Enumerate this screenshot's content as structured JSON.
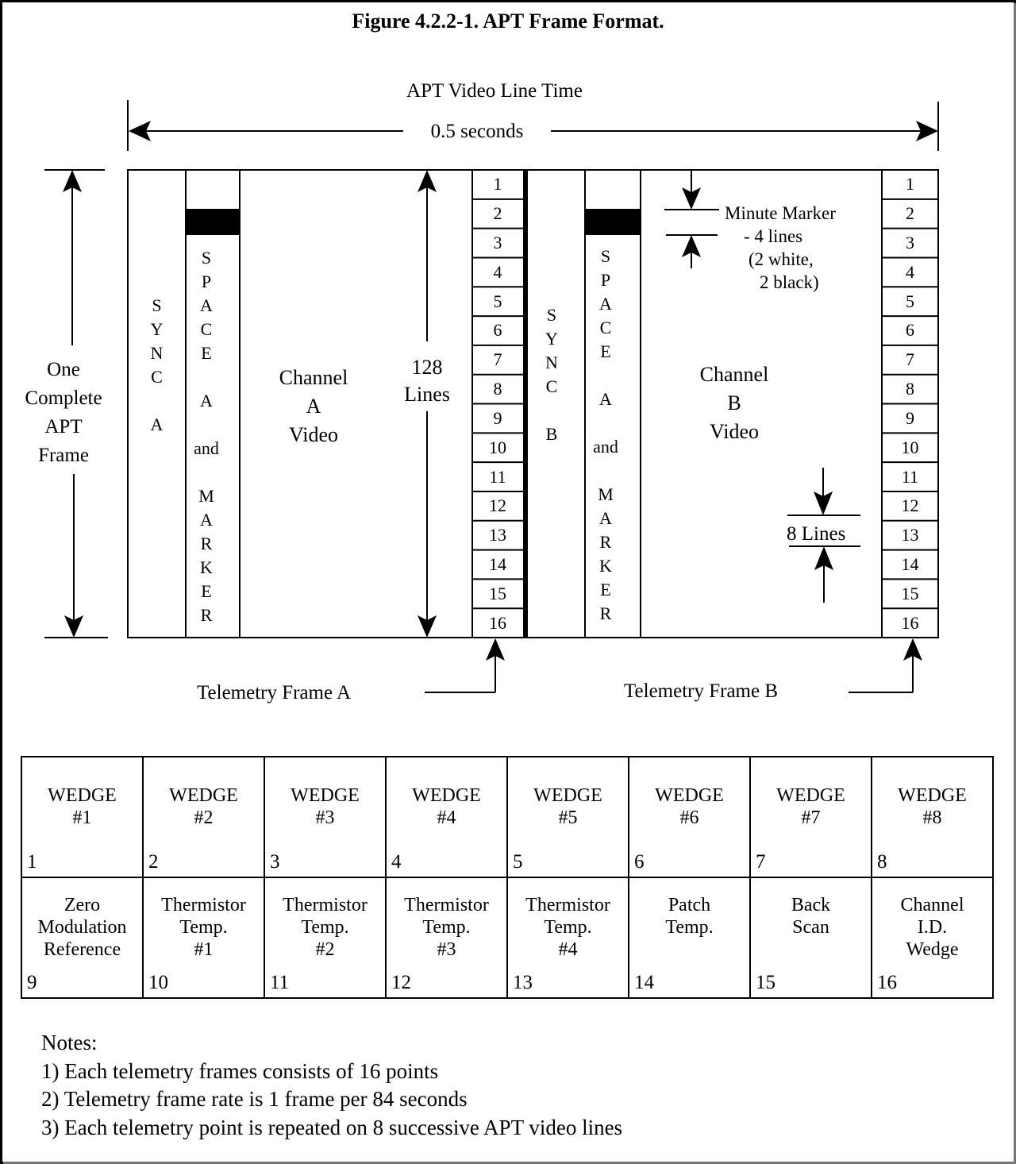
{
  "figure": {
    "title": "Figure 4.2.2-1.  APT Frame Format.",
    "line_time_label": "APT Video Line Time",
    "line_time_value": "0.5 seconds",
    "frame_label": [
      "One",
      "Complete",
      "APT",
      "Frame"
    ],
    "sync_a": [
      "S",
      "Y",
      "N",
      "C",
      "",
      "A"
    ],
    "space_marker_a": [
      "S",
      "P",
      "A",
      "C",
      "E",
      "",
      "A",
      "",
      "and",
      "",
      "M",
      "A",
      "R",
      "K",
      "E",
      "R"
    ],
    "channel_a": [
      "Channel",
      "A",
      "Video"
    ],
    "lines_label": [
      "128",
      "Lines"
    ],
    "sync_b": [
      "S",
      "Y",
      "N",
      "C",
      "",
      "B"
    ],
    "space_marker_b": [
      "S",
      "P",
      "A",
      "C",
      "E",
      "",
      "A",
      "",
      "and",
      "",
      "M",
      "A",
      "R",
      "K",
      "E",
      "R"
    ],
    "channel_b": [
      "Channel",
      "B",
      "Video"
    ],
    "minute_marker": [
      "Minute Marker",
      "- 4 lines",
      "(2 white,",
      "2 black)"
    ],
    "eight_lines": "8 Lines",
    "telemetry_numbers": [
      "1",
      "2",
      "3",
      "4",
      "5",
      "6",
      "7",
      "8",
      "9",
      "10",
      "11",
      "12",
      "13",
      "14",
      "15",
      "16"
    ],
    "telemetry_frame_a": "Telemetry Frame A",
    "telemetry_frame_b": "Telemetry Frame B"
  },
  "telemetry_table": {
    "row1": [
      {
        "label": [
          "WEDGE",
          "#1"
        ],
        "num": "1"
      },
      {
        "label": [
          "WEDGE",
          "#2"
        ],
        "num": "2"
      },
      {
        "label": [
          "WEDGE",
          "#3"
        ],
        "num": "3"
      },
      {
        "label": [
          "WEDGE",
          "#4"
        ],
        "num": "4"
      },
      {
        "label": [
          "WEDGE",
          "#5"
        ],
        "num": "5"
      },
      {
        "label": [
          "WEDGE",
          "#6"
        ],
        "num": "6"
      },
      {
        "label": [
          "WEDGE",
          "#7"
        ],
        "num": "7"
      },
      {
        "label": [
          "WEDGE",
          "#8"
        ],
        "num": "8"
      }
    ],
    "row2": [
      {
        "label": [
          "Zero",
          "Modulation",
          "Reference"
        ],
        "num": "9"
      },
      {
        "label": [
          "Thermistor",
          "Temp.",
          "#1"
        ],
        "num": "10"
      },
      {
        "label": [
          "Thermistor",
          "Temp.",
          "#2"
        ],
        "num": "11"
      },
      {
        "label": [
          "Thermistor",
          "Temp.",
          "#3"
        ],
        "num": "12"
      },
      {
        "label": [
          "Thermistor",
          "Temp.",
          "#4"
        ],
        "num": "13"
      },
      {
        "label": [
          "Patch",
          "Temp."
        ],
        "num": "14"
      },
      {
        "label": [
          "Back",
          "Scan"
        ],
        "num": "15"
      },
      {
        "label": [
          "Channel",
          "I.D.",
          "Wedge"
        ],
        "num": "16"
      }
    ]
  },
  "notes": {
    "heading": "Notes:",
    "items": [
      "1) Each telemetry frames consists of 16 points",
      "2)  Telemetry frame rate is 1 frame per 84 seconds",
      "3) Each telemetry point is repeated on 8 successive APT video lines"
    ]
  }
}
